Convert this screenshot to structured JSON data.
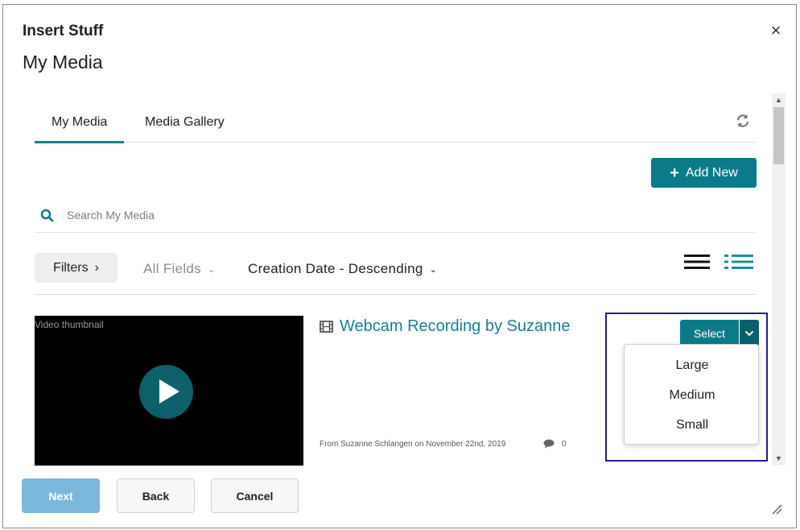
{
  "dialog": {
    "title": "Insert Stuff",
    "subtitle": "My Media",
    "close_label": "×"
  },
  "tabs": [
    {
      "label": "My Media",
      "active": true
    },
    {
      "label": "Media Gallery",
      "active": false
    }
  ],
  "icons": {
    "refresh": "refresh-icon",
    "search": "search-icon",
    "list_view": "list-view-icon",
    "detail_view": "detail-view-icon",
    "film": "film-icon",
    "comment": "comment-icon",
    "play": "play-icon"
  },
  "toolbar": {
    "add_new_label": "Add New",
    "add_new_icon": "+"
  },
  "search": {
    "placeholder": "Search My Media",
    "value": ""
  },
  "filters": {
    "filters_label": "Filters",
    "filters_chevron": "›",
    "fields_label": "All Fields",
    "sort_label": "Creation Date - Descending",
    "caret": "⌄"
  },
  "media": {
    "thumbnail_alt": "Video thumbnail",
    "title": "Webcam Recording by Suzanne",
    "meta": "From Suzanne Schlangen on November 22nd, 2019",
    "comment_count": "0"
  },
  "select": {
    "label": "Select",
    "options": [
      "Large",
      "Medium",
      "Small"
    ]
  },
  "footer": {
    "next_label": "Next",
    "back_label": "Back",
    "cancel_label": "Cancel"
  },
  "colors": {
    "accent": "#0b7b8b",
    "accent_dark": "#075f6c",
    "link": "#1a7f8e",
    "next_disabled": "#7ab8dd",
    "highlight_border": "#231f8c"
  }
}
